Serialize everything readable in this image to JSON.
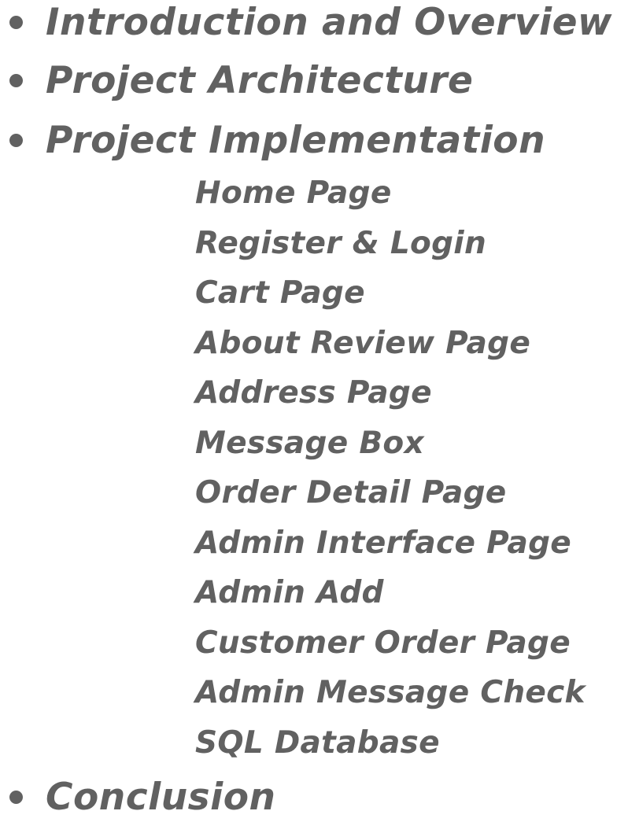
{
  "outline": {
    "items": [
      {
        "label": "Introduction and Overview"
      },
      {
        "label": "Project Architecture"
      },
      {
        "label": "Project Implementation"
      },
      {
        "label": "Conclusion"
      }
    ],
    "implementation_subitems": [
      "Home Page",
      "Register & Login",
      "Cart Page",
      "About Review Page",
      "Address Page",
      "Message Box",
      "Order Detail Page",
      "Admin Interface Page",
      "Admin Add",
      "Customer Order Page",
      "Admin Message Check",
      "SQL Database"
    ]
  },
  "colors": {
    "text": "#616161",
    "background": "#ffffff"
  }
}
